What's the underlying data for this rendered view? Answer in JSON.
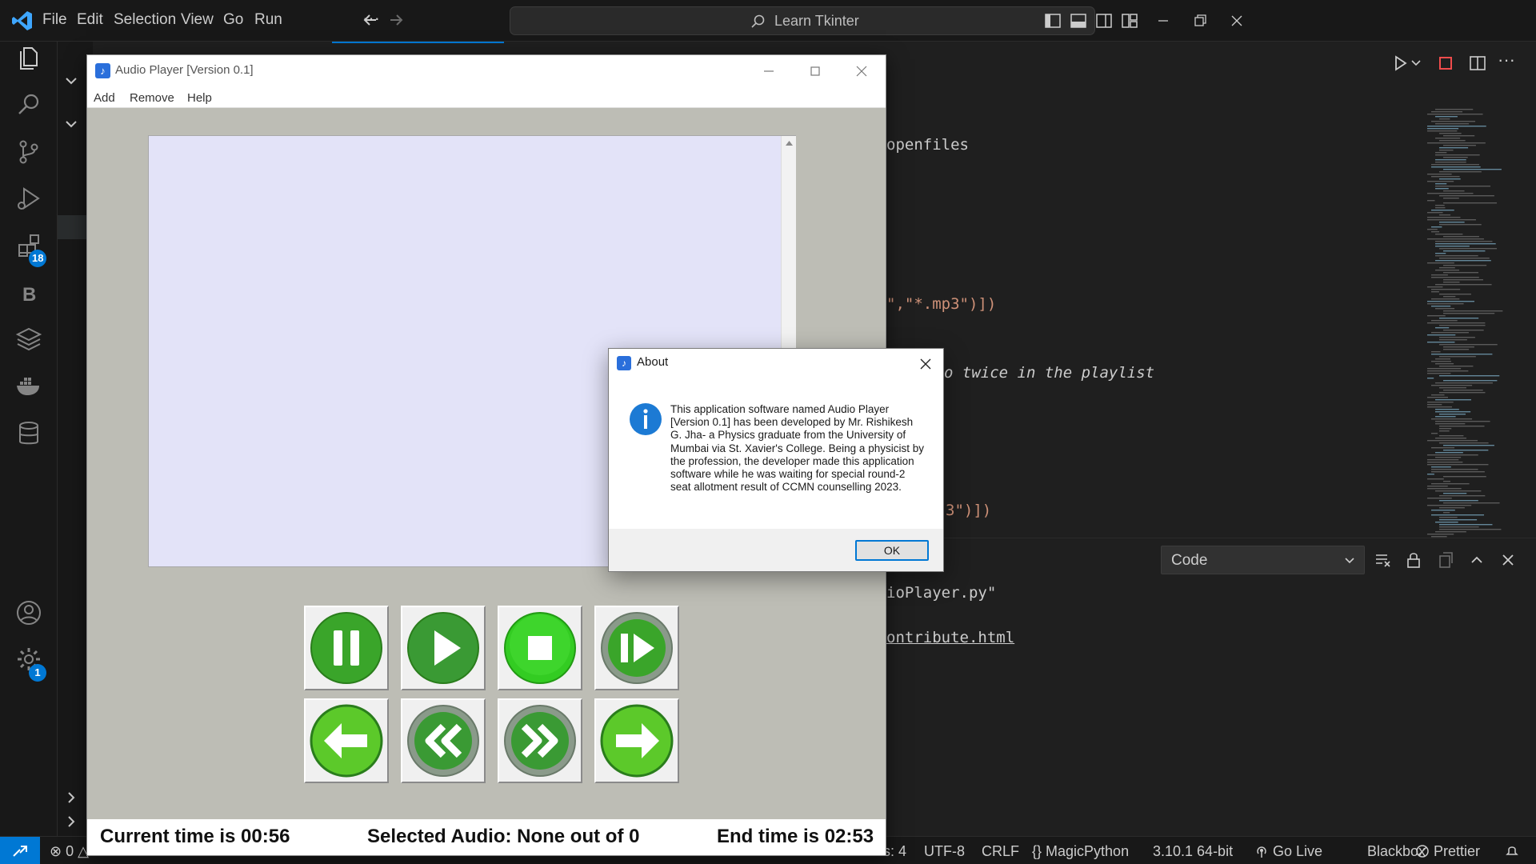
{
  "vscode": {
    "menu": [
      "File",
      "Edit",
      "Selection",
      "View",
      "Go",
      "Run"
    ],
    "menu_more": "···",
    "command_center": "Learn Tkinter",
    "badges": {
      "extensions": "18",
      "settings": "1"
    },
    "code_lines": [
      {
        "text": "openfiles",
        "color": "#cccccc",
        "italic": false
      },
      {
        "text": "\",\"*.mp3\")])",
        "color": "#ce9178",
        "italic": false
      },
      {
        "text": "o twice in the playlist",
        "color": "#cccccc",
        "italic": true
      },
      {
        "text": "3\")])",
        "color": "#ce9178",
        "italic": false
      }
    ],
    "panel": {
      "select_value": "Code",
      "lines": [
        {
          "text": "ioPlayer.py\"",
          "underline": false
        },
        {
          "text": "ontribute.html",
          "underline": true
        }
      ]
    },
    "status": [
      "⊗ 0 △",
      "s: 4",
      "UTF-8",
      "CRLF",
      "{} MagicPython",
      "3.10.1 64-bit",
      "Go Live",
      "Blackbox",
      "Prettier"
    ]
  },
  "audio_player": {
    "title": "Audio Player [Version 0.1]",
    "menu": [
      "Add",
      "Remove",
      "Help"
    ],
    "current_time": "Current time is 00:56",
    "selected_audio": "Selected Audio: None out of 0",
    "end_time": "End time is 02:53",
    "buttons": [
      "pause",
      "play",
      "stop",
      "resume",
      "previous",
      "rewind",
      "fast-forward",
      "next"
    ]
  },
  "about": {
    "title": "About",
    "message": "This application software named Audio Player [Version 0.1] has been developed by Mr. Rishikesh G. Jha- a Physics graduate from the University of Mumbai via St. Xavier's College. Being a physicist by the profession, the developer made this application software while he was waiting for special round-2 seat allotment result of CCMN counselling 2023.",
    "ok": "OK"
  },
  "colors": {
    "accent": "#0078d4",
    "player_bg": "#bdbdb5",
    "playlist_bg": "#e3e3f8",
    "button_green": "#3aa52a"
  }
}
